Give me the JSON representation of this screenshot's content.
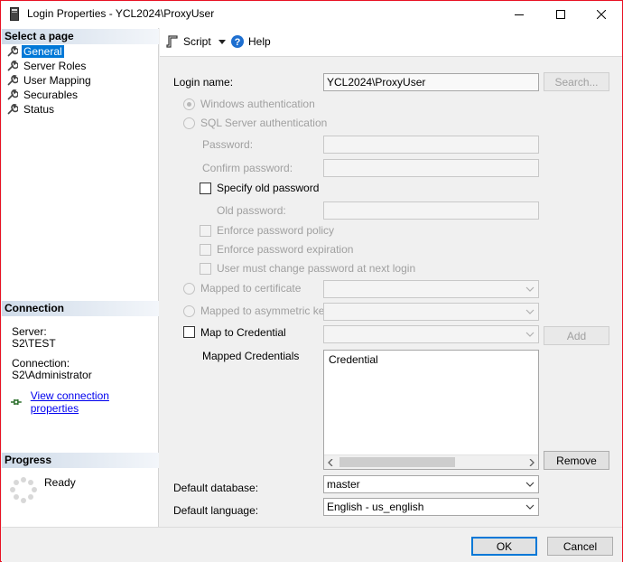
{
  "window": {
    "title": "Login Properties - YCL2024\\ProxyUser",
    "minimize_glyph": "—",
    "maximize_glyph": "☐",
    "close_glyph": "✕"
  },
  "sidebar": {
    "select_page_header": "Select a page",
    "pages": [
      {
        "label": "General",
        "icon": "wrench-icon",
        "selected": true
      },
      {
        "label": "Server Roles",
        "icon": "wrench-icon",
        "selected": false
      },
      {
        "label": "User Mapping",
        "icon": "wrench-icon",
        "selected": false
      },
      {
        "label": "Securables",
        "icon": "wrench-icon",
        "selected": false
      },
      {
        "label": "Status",
        "icon": "wrench-icon",
        "selected": false
      }
    ],
    "connection_header": "Connection",
    "server_label": "Server:",
    "server_value": "S2\\TEST",
    "connection_label": "Connection:",
    "connection_value": "S2\\Administrator",
    "view_props_link": "View connection properties",
    "progress_header": "Progress",
    "progress_status": "Ready"
  },
  "toolbar": {
    "script_label": "Script",
    "help_label": "Help"
  },
  "form": {
    "login_name_label": "Login name:",
    "login_name_value": "YCL2024\\ProxyUser",
    "search_button": "Search...",
    "windows_auth_label": "Windows authentication",
    "sql_auth_label": "SQL Server authentication",
    "password_label": "Password:",
    "confirm_password_label": "Confirm password:",
    "specify_old_password_label": "Specify old password",
    "old_password_label": "Old password:",
    "enforce_policy_label": "Enforce password policy",
    "enforce_expiration_label": "Enforce password expiration",
    "must_change_label": "User must change password at next login",
    "mapped_cert_label": "Mapped to certificate",
    "mapped_asym_label": "Mapped to asymmetric key",
    "map_credential_label": "Map to Credential",
    "add_button": "Add",
    "mapped_credentials_label": "Mapped Credentials",
    "credentials_column_header": "Credential",
    "remove_button": "Remove",
    "default_db_label": "Default database:",
    "default_db_value": "master",
    "default_lang_label": "Default language:",
    "default_lang_value": "English - us_english"
  },
  "footer": {
    "ok_button": "OK",
    "cancel_button": "Cancel"
  },
  "colors": {
    "selection": "#0078d7",
    "window_border": "#e81123",
    "help_icon": "#1e6fd0"
  }
}
